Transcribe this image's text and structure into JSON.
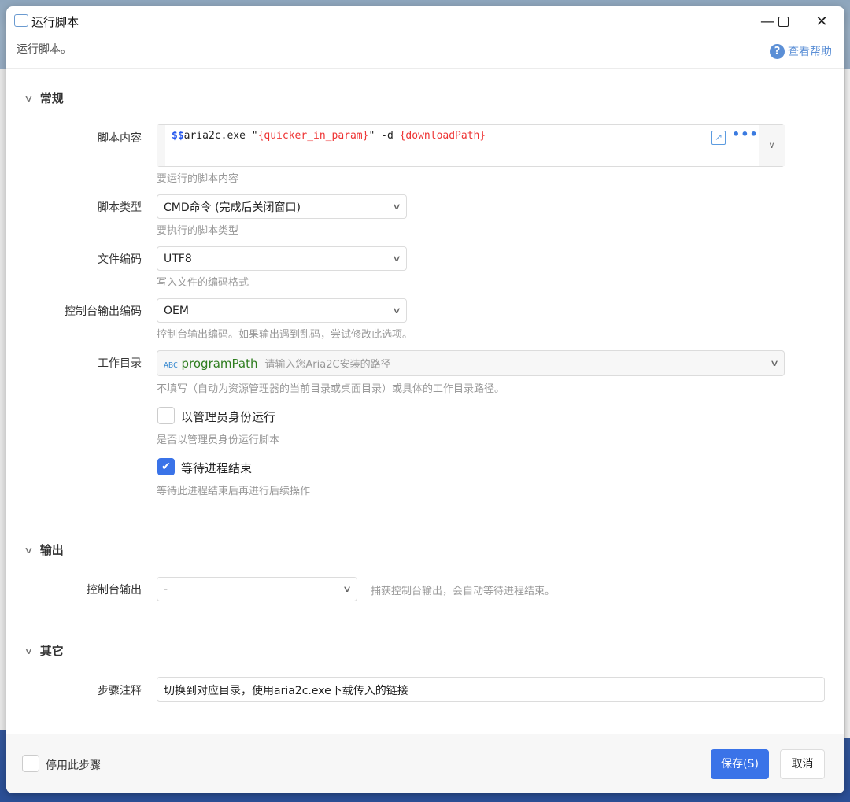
{
  "window": {
    "title": "运行脚本",
    "subtitle": "运行脚本。",
    "help_label": "查看帮助",
    "minimize": "—",
    "maximize": "☐",
    "close": "✕"
  },
  "sections": {
    "general": "常规",
    "output": "输出",
    "other": "其它"
  },
  "script": {
    "label": "脚本内容",
    "prefix": "$$",
    "cmd": "aria2c.exe \"",
    "param1": "{quicker_in_param}",
    "mid": "\" -d ",
    "param2": "{downloadPath}",
    "hint": "要运行的脚本内容"
  },
  "script_type": {
    "label": "脚本类型",
    "value": "CMD命令 (完成后关闭窗口)",
    "hint": "要执行的脚本类型"
  },
  "file_encoding": {
    "label": "文件编码",
    "value": "UTF8",
    "hint": "写入文件的编码格式"
  },
  "console_encoding": {
    "label": "控制台输出编码",
    "value": "OEM",
    "hint": "控制台输出编码。如果输出遇到乱码，尝试修改此选项。"
  },
  "workdir": {
    "label": "工作目录",
    "type_badge": "ABC",
    "variable": "programPath",
    "var_desc": "请输入您Aria2C安装的路径",
    "hint": "不填写（自动为资源管理器的当前目录或桌面目录）或具体的工作目录路径。"
  },
  "run_as_admin": {
    "label": "以管理员身份运行",
    "checked": false,
    "hint": "是否以管理员身份运行脚本"
  },
  "wait_exit": {
    "label": "等待进程结束",
    "checked": true,
    "hint": "等待此进程结束后再进行后续操作"
  },
  "console_output": {
    "label": "控制台输出",
    "value": "-",
    "hint": "捕获控制台输出，会自动等待进程结束。"
  },
  "step_note": {
    "label": "步骤注释",
    "value": "切换到对应目录，使用aria2c.exe下载传入的链接"
  },
  "footer": {
    "disable_label": "停用此步骤",
    "save": "保存(S)",
    "cancel": "取消"
  }
}
